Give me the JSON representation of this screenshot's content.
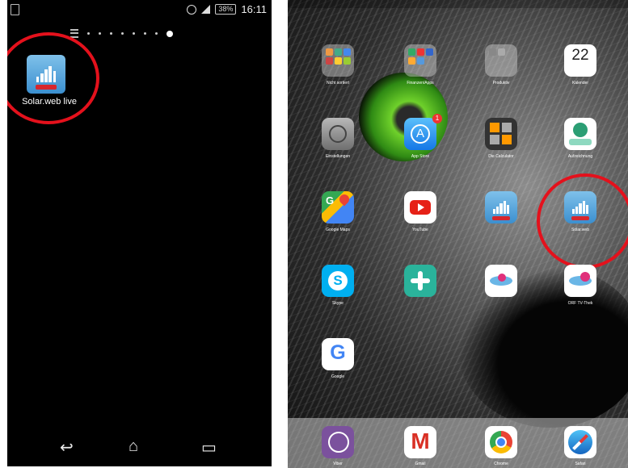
{
  "android": {
    "status": {
      "battery": "38%",
      "time": "16:11"
    },
    "page_dots": 8,
    "app": {
      "label": "Solar.web live"
    }
  },
  "ipad": {
    "calendar_day": "22",
    "labels": [
      "Nicht sortiert",
      "Finanzen/Apps",
      "Produktiv",
      "Kalender",
      "Einstellungen",
      "App Store",
      "Die Calculator",
      "Aufzeichnung",
      "Google Maps",
      "YouTube",
      "",
      "Solar.web",
      "Skype",
      "",
      "",
      "ORF TV-Thek",
      "Google"
    ],
    "dock_labels": [
      "Viber",
      "Gmail",
      "Chrome",
      "Safari"
    ],
    "badge": "1"
  },
  "colors": {
    "highlight_circle": "#e4111c",
    "solar_red": "#d8262c",
    "android_bg": "#000000"
  }
}
